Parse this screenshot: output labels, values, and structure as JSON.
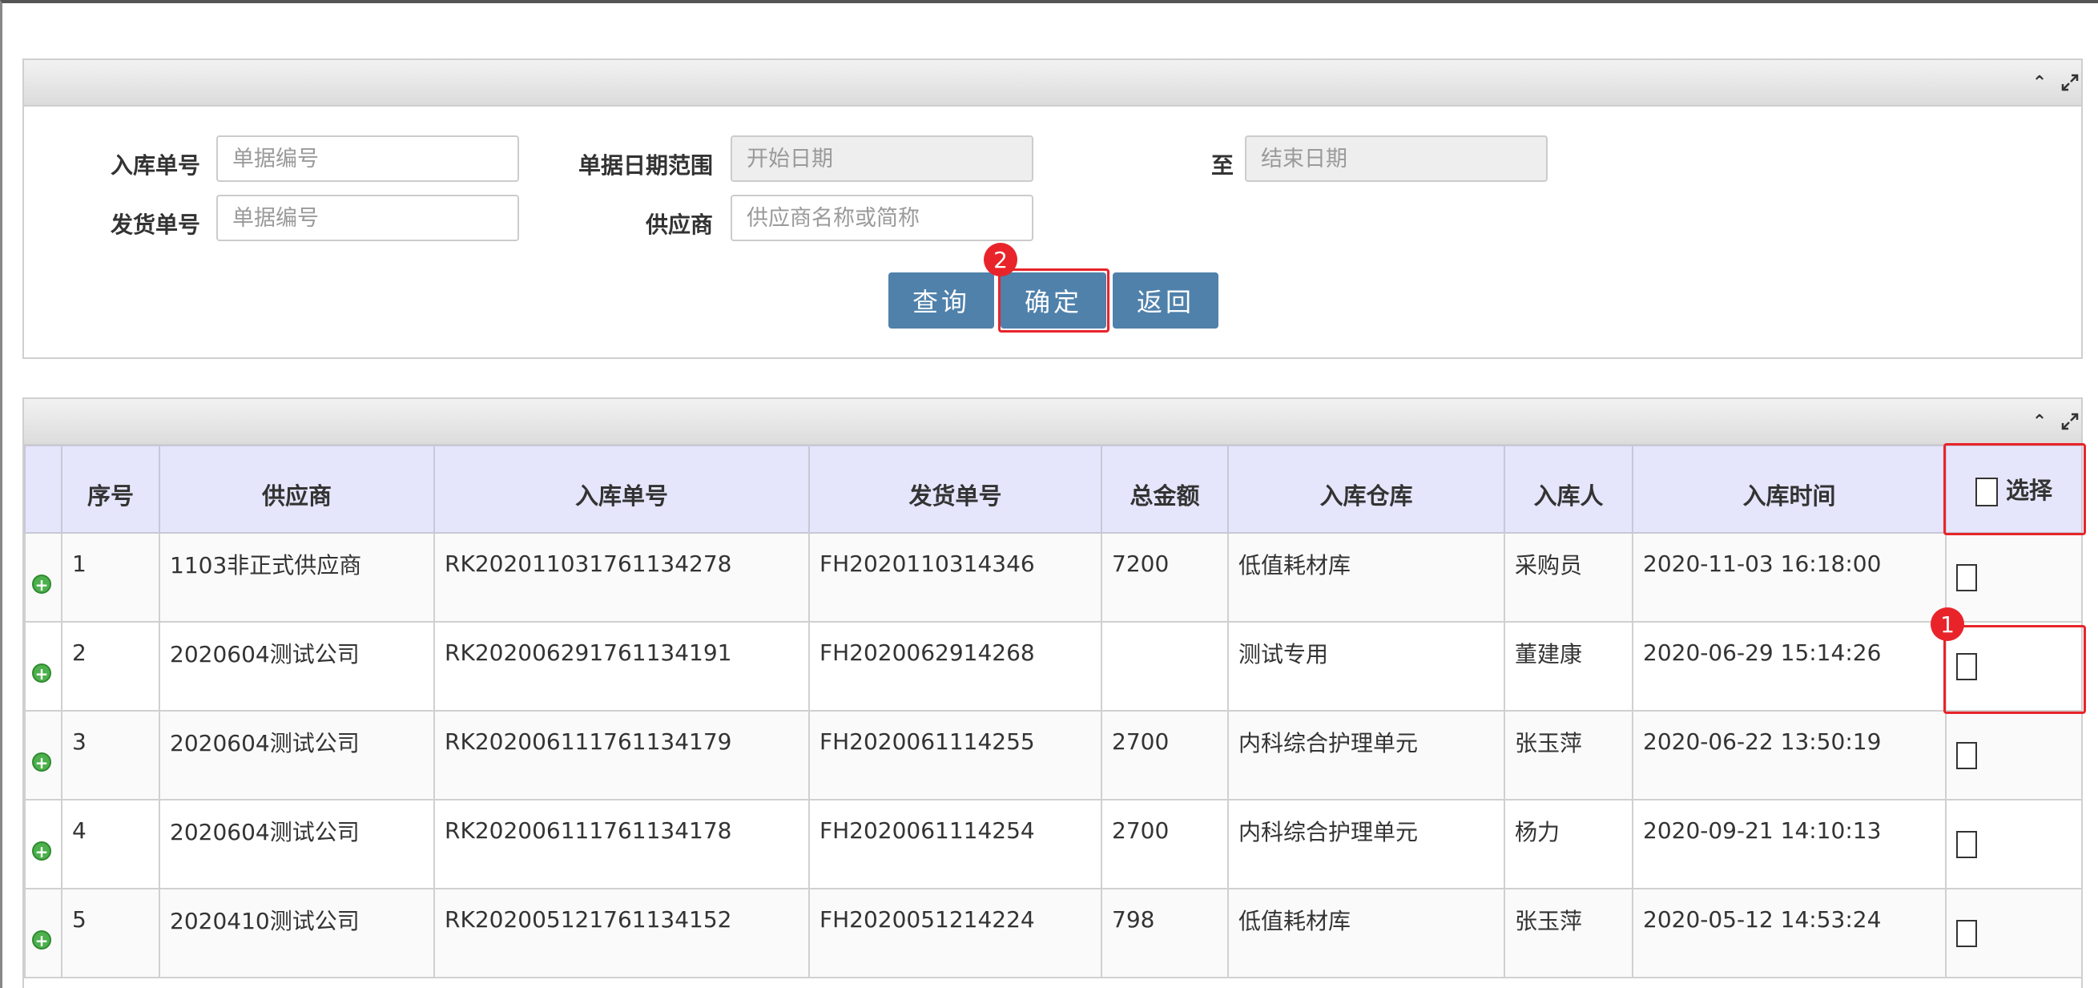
{
  "search": {
    "labels": {
      "receipt_no": "入库单号",
      "delivery_no": "发货单号",
      "date_range": "单据日期范围",
      "to": "至",
      "supplier": "供应商"
    },
    "placeholders": {
      "receipt_no": "单据编号",
      "delivery_no": "单据编号",
      "start_date": "开始日期",
      "end_date": "结束日期",
      "supplier": "供应商名称或简称"
    },
    "buttons": {
      "query": "查询",
      "confirm": "确定",
      "back": "返回"
    }
  },
  "annotations": {
    "marker1": "1",
    "marker2": "2",
    "highlight_color": "#e8242a"
  },
  "table": {
    "headers": {
      "index": "序号",
      "supplier": "供应商",
      "receipt_no": "入库单号",
      "delivery_no": "发货单号",
      "amount": "总金额",
      "warehouse": "入库仓库",
      "person": "入库人",
      "time": "入库时间",
      "select": "选择"
    },
    "rows": [
      {
        "index": "1",
        "supplier": "1103非正式供应商",
        "receipt_no": "RK202011031761134278",
        "delivery_no": "FH2020110314346",
        "amount": "7200",
        "warehouse": "低值耗材库",
        "person": "采购员",
        "time": "2020-11-03 16:18:00"
      },
      {
        "index": "2",
        "supplier": "2020604测试公司",
        "receipt_no": "RK202006291761134191",
        "delivery_no": "FH2020062914268",
        "amount": "",
        "warehouse": "测试专用",
        "person": "董建康",
        "time": "2020-06-29 15:14:26"
      },
      {
        "index": "3",
        "supplier": "2020604测试公司",
        "receipt_no": "RK202006111761134179",
        "delivery_no": "FH2020061114255",
        "amount": "2700",
        "warehouse": "内科综合护理单元",
        "person": "张玉萍",
        "time": "2020-06-22 13:50:19"
      },
      {
        "index": "4",
        "supplier": "2020604测试公司",
        "receipt_no": "RK202006111761134178",
        "delivery_no": "FH2020061114254",
        "amount": "2700",
        "warehouse": "内科综合护理单元",
        "person": "杨力",
        "time": "2020-09-21 14:10:13"
      },
      {
        "index": "5",
        "supplier": "2020410测试公司",
        "receipt_no": "RK202005121761134152",
        "delivery_no": "FH2020051214224",
        "amount": "798",
        "warehouse": "低值耗材库",
        "person": "张玉萍",
        "time": "2020-05-12 14:53:24"
      }
    ]
  },
  "colors": {
    "button": "#4f81ab",
    "header_bg": "#e5e5fb",
    "expand_icon": "#4cb04c"
  },
  "icons": {
    "collapse": "chevron-up-icon",
    "maximize": "expand-icon",
    "row_expand": "plus-circle-icon"
  }
}
